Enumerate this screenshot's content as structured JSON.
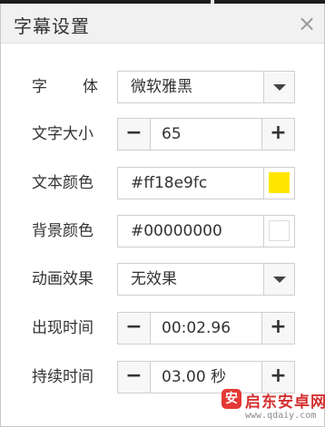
{
  "dialog": {
    "title": "字幕设置",
    "close_glyph": "×"
  },
  "font": {
    "label_chars": [
      "字",
      "体"
    ],
    "value": "微软雅黑"
  },
  "font_size": {
    "label": "文字大小",
    "value": "65",
    "minus": "−",
    "plus": "+"
  },
  "text_color": {
    "label": "文本颜色",
    "value": "#ff18e9fc",
    "swatch_color": "#ffe600"
  },
  "bg_color": {
    "label": "背景颜色",
    "value": "#00000000",
    "swatch_color": "#ffffff"
  },
  "animation": {
    "label": "动画效果",
    "value": "无效果"
  },
  "appear_time": {
    "label": "出现时间",
    "value": "00:02.96",
    "minus": "−",
    "plus": "+"
  },
  "duration": {
    "label": "持续时间",
    "value": "03.00 秒",
    "minus": "−",
    "plus": "+"
  },
  "watermark": {
    "logo_char": "安",
    "site_name": "启东安卓网",
    "url": "www.qdaiy.com"
  },
  "icons": {
    "dropdown": "chevron-down-icon",
    "close": "close-icon"
  }
}
